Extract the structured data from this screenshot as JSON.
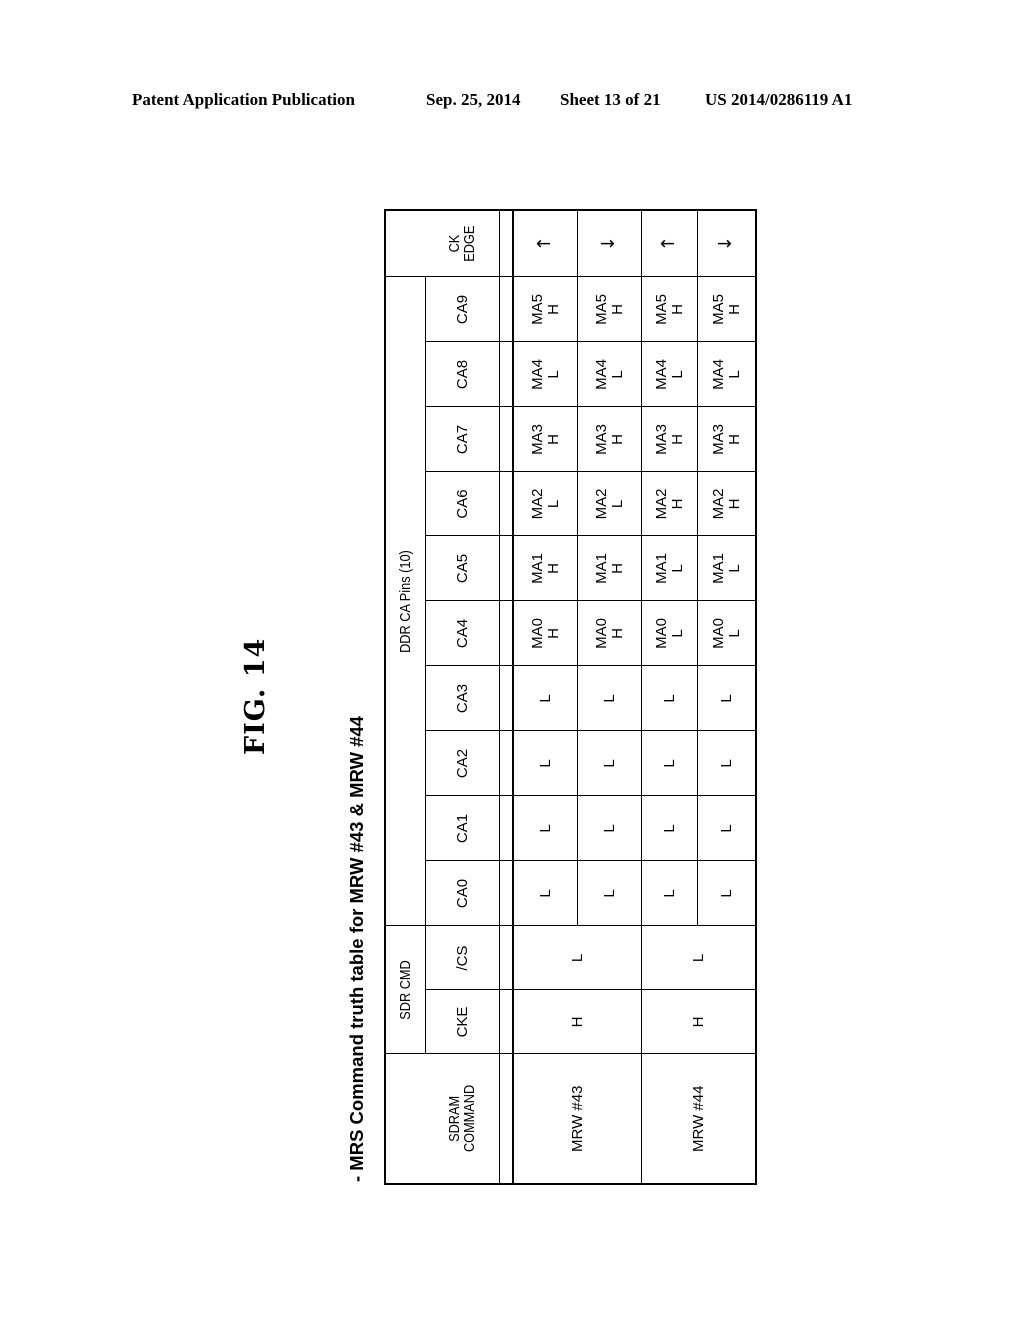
{
  "header": {
    "publication": "Patent Application Publication",
    "date": "Sep. 25, 2014",
    "sheet": "Sheet 13 of 21",
    "number": "US 2014/0286119 A1"
  },
  "figure": {
    "label": "FIG. 14",
    "caption": "- MRS Command truth table for MRW #43 & MRW #44"
  },
  "table": {
    "group_headers": {
      "sdr_cmd": "SDR CMD",
      "ddr_ca_pins": "DDR CA Pins (10)"
    },
    "column_headers": {
      "sdram_command_line1": "SDRAM",
      "sdram_command_line2": "COMMAND",
      "cke": "CKE",
      "cs": "/CS",
      "ca": [
        "CA0",
        "CA1",
        "CA2",
        "CA3",
        "CA4",
        "CA5",
        "CA6",
        "CA7",
        "CA8",
        "CA9"
      ],
      "ck_edge_line1": "CK",
      "ck_edge_line2": "EDGE"
    },
    "commands": [
      {
        "name": "MRW #43",
        "cke": "H",
        "cs": "L"
      },
      {
        "name": "MRW #44",
        "cke": "H",
        "cs": "L"
      }
    ],
    "rows": [
      {
        "ca0": "L",
        "ca1": "L",
        "ca2": "L",
        "ca3": "L",
        "ca4": [
          "MA0",
          "H"
        ],
        "ca5": [
          "MA1",
          "H"
        ],
        "ca6": [
          "MA2",
          "L"
        ],
        "ca7": [
          "MA3",
          "H"
        ],
        "ca8": [
          "MA4",
          "L"
        ],
        "ca9": [
          "MA5",
          "H"
        ],
        "ck_edge": "↑",
        "ck_edge_meaning": "rising"
      },
      {
        "ca0": "L",
        "ca1": "L",
        "ca2": "L",
        "ca3": "L",
        "ca4": [
          "MA0",
          "H"
        ],
        "ca5": [
          "MA1",
          "H"
        ],
        "ca6": [
          "MA2",
          "L"
        ],
        "ca7": [
          "MA3",
          "H"
        ],
        "ca8": [
          "MA4",
          "L"
        ],
        "ca9": [
          "MA5",
          "H"
        ],
        "ck_edge": "↓",
        "ck_edge_meaning": "falling"
      },
      {
        "ca0": "L",
        "ca1": "L",
        "ca2": "L",
        "ca3": "L",
        "ca4": [
          "MA0",
          "L"
        ],
        "ca5": [
          "MA1",
          "L"
        ],
        "ca6": [
          "MA2",
          "H"
        ],
        "ca7": [
          "MA3",
          "H"
        ],
        "ca8": [
          "MA4",
          "L"
        ],
        "ca9": [
          "MA5",
          "H"
        ],
        "ck_edge": "↑",
        "ck_edge_meaning": "rising"
      },
      {
        "ca0": "L",
        "ca1": "L",
        "ca2": "L",
        "ca3": "L",
        "ca4": [
          "MA0",
          "L"
        ],
        "ca5": [
          "MA1",
          "L"
        ],
        "ca6": [
          "MA2",
          "H"
        ],
        "ca7": [
          "MA3",
          "H"
        ],
        "ca8": [
          "MA4",
          "L"
        ],
        "ca9": [
          "MA5",
          "H"
        ],
        "ck_edge": "↓",
        "ck_edge_meaning": "falling"
      }
    ]
  }
}
